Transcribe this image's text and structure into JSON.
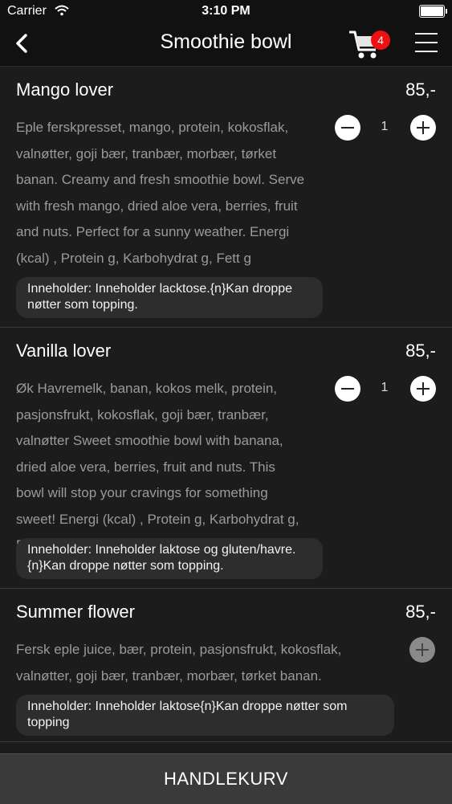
{
  "status_bar": {
    "carrier": "Carrier",
    "time": "3:10 PM"
  },
  "nav": {
    "title": "Smoothie bowl",
    "cart_count": "4",
    "accent_color": "#e11111"
  },
  "products": [
    {
      "name": "Mango lover",
      "price": "85,-",
      "description": "Eple ferskpresset, mango, protein, kokosflak, valnøtter, goji bær, tranbær, morbær, tørket banan. Creamy and fresh smoothie bowl. Serve with fresh mango, dried aloe vera, berries, fruit and nuts. Perfect for a sunny weather. Energi (kcal) , Protein g, Karbohydrat g, Fett g",
      "note": "Inneholder: Inneholder lacktose.{n}Kan droppe nøtter som topping.",
      "quantity": "1"
    },
    {
      "name": "Vanilla lover",
      "price": "85,-",
      "description": "Øk Havremelk, banan, kokos melk, protein, pasjonsfrukt, kokosflak, goji bær, tranbær, valnøtter Sweet smoothie bowl with banana, dried aloe vera, berries, fruit and nuts. This bowl will stop your cravings for something sweet! Energi (kcal) , Protein g, Karbohydrat g, Fett g",
      "note": "Inneholder: Inneholder laktose og gluten/havre.{n}Kan droppe nøtter som topping.",
      "quantity": "1"
    },
    {
      "name": "Summer flower",
      "price": "85,-",
      "description": "Fersk eple juice, bær, protein, pasjonsfrukt, kokosflak, valnøtter, goji bær, tranbær, morbær, tørket banan.",
      "note": "Inneholder: Inneholder laktose{n}Kan droppe nøtter som topping"
    }
  ],
  "bottom_bar": {
    "label": "HANDLEKURV"
  }
}
